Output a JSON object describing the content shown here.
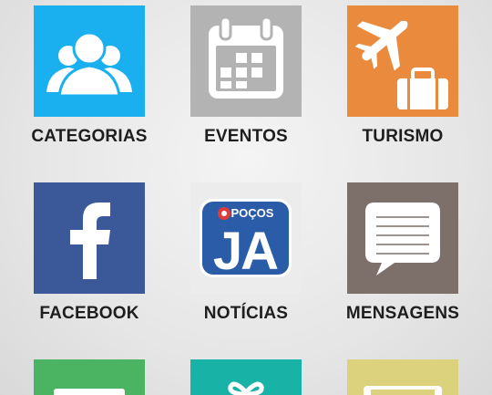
{
  "tiles": [
    {
      "id": "categorias",
      "label": "CATEGORIAS",
      "icon": "people-group-icon",
      "color": "#1ab0f0"
    },
    {
      "id": "eventos",
      "label": "EVENTOS",
      "icon": "calendar-icon",
      "color": "#b3b3b3"
    },
    {
      "id": "turismo",
      "label": "TURISMO",
      "icon": "airplane-suitcase-icon",
      "color": "#ea8a3c"
    },
    {
      "id": "facebook",
      "label": "FACEBOOK",
      "icon": "facebook-icon",
      "color": "#3b5998"
    },
    {
      "id": "noticias",
      "label": "NOTÍCIAS",
      "icon": "pocos-ja-logo",
      "color": "#ececec"
    },
    {
      "id": "mensagens",
      "label": "MENSAGENS",
      "icon": "message-bubble-icon",
      "color": "#7d706b"
    },
    {
      "id": "row3-left",
      "label": "",
      "icon": "green-tile-icon",
      "color": "#4ab463"
    },
    {
      "id": "row3-middle",
      "label": "",
      "icon": "gift-icon",
      "color": "#18b3a6"
    },
    {
      "id": "row3-right",
      "label": "",
      "icon": "card-icon",
      "color": "#dcd27e"
    }
  ],
  "logo": {
    "top_text": "POÇOS",
    "main_text": "JA"
  }
}
